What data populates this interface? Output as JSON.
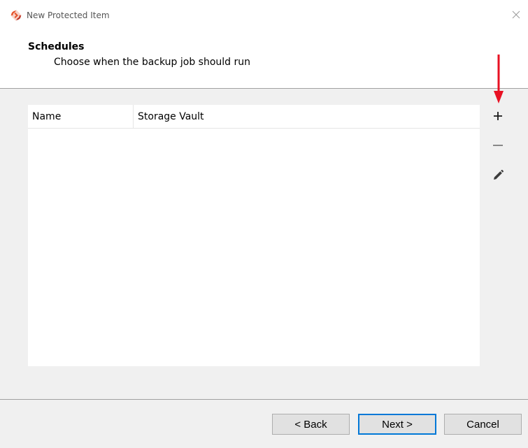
{
  "window": {
    "title": "New Protected Item",
    "close_glyph": "✕"
  },
  "header": {
    "title": "Schedules",
    "subtitle": "Choose when the backup job should run"
  },
  "table": {
    "columns": [
      "Name",
      "Storage Vault"
    ],
    "rows": []
  },
  "side_toolbar": {
    "add_icon": "plus-icon",
    "remove_icon": "minus-icon",
    "edit_icon": "pencil-icon"
  },
  "footer": {
    "back_label": "< Back",
    "next_label": "Next >",
    "cancel_label": "Cancel"
  },
  "colors": {
    "annotation_arrow": "#e81123",
    "app_icon_primary": "#e5542c",
    "focus_border": "#0078d7"
  }
}
